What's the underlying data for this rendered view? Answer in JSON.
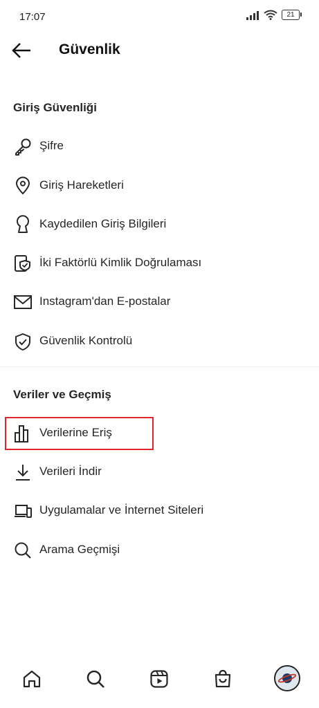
{
  "status_bar": {
    "time": "17:07",
    "battery": "21"
  },
  "header": {
    "title": "Güvenlik"
  },
  "sections": [
    {
      "title": "Giriş Güvenliği",
      "items": [
        {
          "label": "Şifre",
          "icon": "key-icon"
        },
        {
          "label": "Giriş Hareketleri",
          "icon": "location-pin-icon"
        },
        {
          "label": "Kaydedilen Giriş Bilgileri",
          "icon": "keyhole-icon"
        },
        {
          "label": "İki Faktörlü Kimlik Doğrulaması",
          "icon": "phone-shield-icon"
        },
        {
          "label": "Instagram'dan E-postalar",
          "icon": "mail-icon"
        },
        {
          "label": "Güvenlik Kontrolü",
          "icon": "shield-check-icon"
        }
      ]
    },
    {
      "title": "Veriler ve Geçmiş",
      "items": [
        {
          "label": "Verilerine Eriş",
          "icon": "bar-chart-icon"
        },
        {
          "label": "Verileri İndir",
          "icon": "download-icon"
        },
        {
          "label": "Uygulamalar ve İnternet Siteleri",
          "icon": "laptop-phone-icon"
        },
        {
          "label": "Arama Geçmişi",
          "icon": "search-icon"
        }
      ]
    }
  ],
  "highlight_color": "#e0242a",
  "bottom_nav": [
    "home-icon",
    "search-icon",
    "reels-icon",
    "shop-icon",
    "avatar"
  ]
}
